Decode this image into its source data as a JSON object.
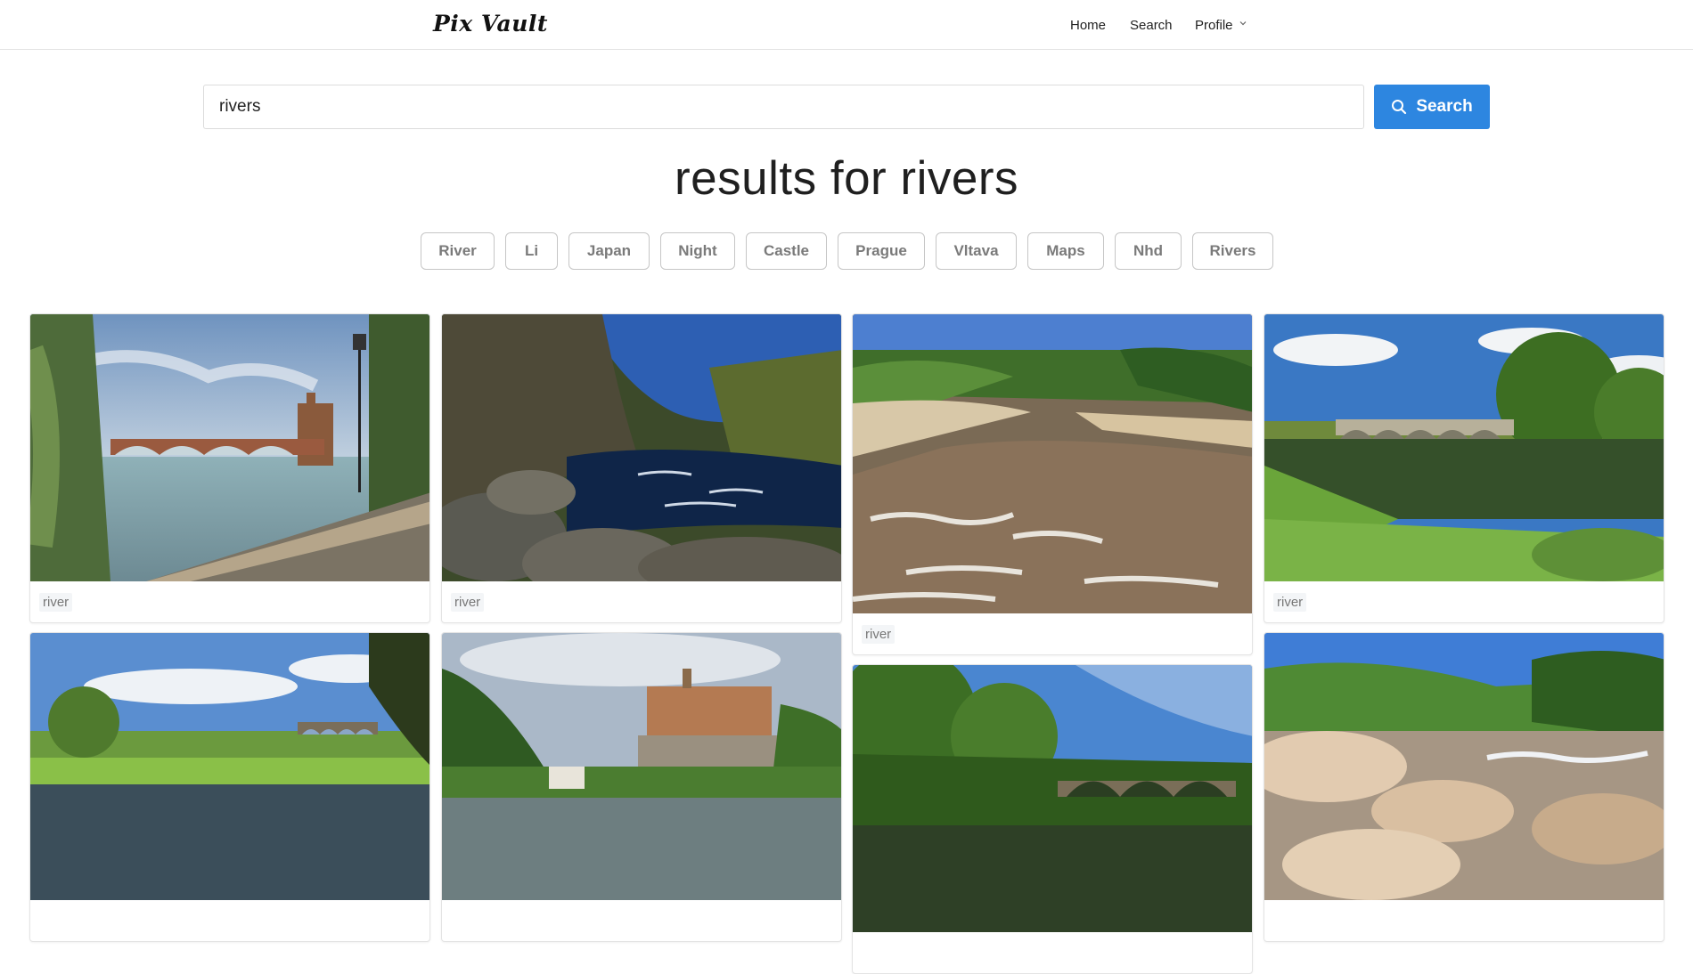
{
  "nav": {
    "brand": "Pix Vault",
    "home": "Home",
    "search": "Search",
    "profile": "Profile"
  },
  "search": {
    "value": "rivers",
    "button_label": "Search"
  },
  "heading": "results for rivers",
  "tags": [
    "River",
    "Li",
    "Japan",
    "Night",
    "Castle",
    "Prague",
    "Vltava",
    "Maps",
    "Nhd",
    "Rivers"
  ],
  "results": [
    {
      "label": "river",
      "scene": "stone-bridge-with-castle-and-lamppost"
    },
    {
      "label": "river",
      "scene": "rocky-river-with-forest"
    },
    {
      "label": "river",
      "scene": "rapids-with-sandstone-banks"
    },
    {
      "label": "river",
      "scene": "stone-bridge-with-trees"
    },
    {
      "label": "",
      "scene": "river-with-viaduct"
    },
    {
      "label": "",
      "scene": "castle-on-cliff-above-river"
    },
    {
      "label": "",
      "scene": "arched-bridge-in-woods"
    },
    {
      "label": "",
      "scene": "rocky-river-bank"
    }
  ],
  "colors": {
    "accent": "#2d86e0",
    "tag_text": "#7a7a7a",
    "label_bg": "#f3f5f7"
  }
}
